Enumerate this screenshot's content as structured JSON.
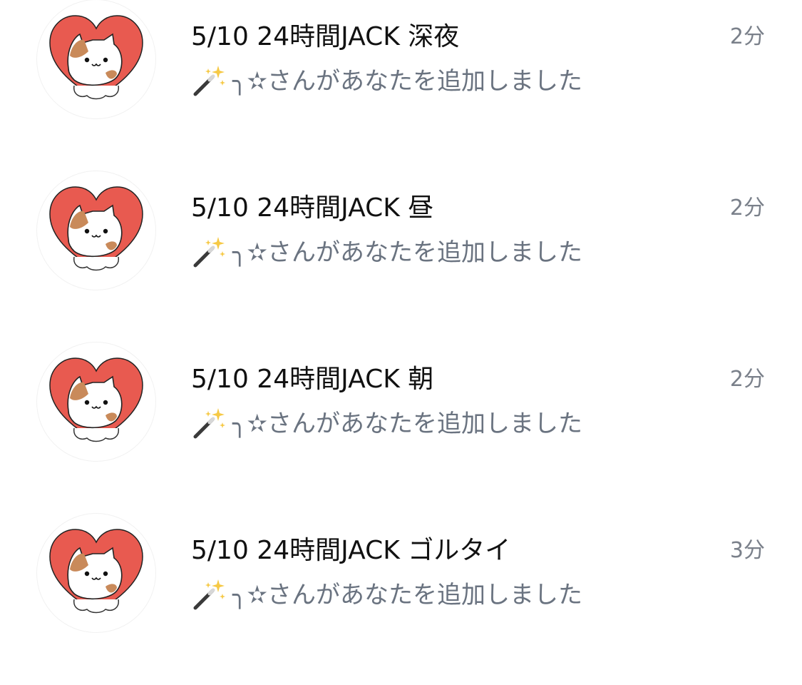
{
  "chats": [
    {
      "title": "5/10 24時間JACK 深夜",
      "time": "2分",
      "preview_sender": "╮✫",
      "preview_text": "さんがあなたを追加しました",
      "avatar_icon": "cat-heart-icon",
      "preview_icon": "magic-wand-icon"
    },
    {
      "title": "5/10 24時間JACK 昼",
      "time": "2分",
      "preview_sender": "╮✫",
      "preview_text": "さんがあなたを追加しました",
      "avatar_icon": "cat-heart-icon",
      "preview_icon": "magic-wand-icon"
    },
    {
      "title": "5/10 24時間JACK 朝",
      "time": "2分",
      "preview_sender": "╮✫",
      "preview_text": "さんがあなたを追加しました",
      "avatar_icon": "cat-heart-icon",
      "preview_icon": "magic-wand-icon"
    },
    {
      "title": "5/10 24時間JACK ゴルタイ",
      "time": "3分",
      "preview_sender": "╮✫",
      "preview_text": "さんがあなたを追加しました",
      "avatar_icon": "cat-heart-icon",
      "preview_icon": "magic-wand-icon"
    }
  ],
  "colors": {
    "heart": "#e85a50",
    "cat_patch": "#c98a5a",
    "title": "#111111",
    "muted": "#6a7380",
    "time": "#7a808a"
  }
}
